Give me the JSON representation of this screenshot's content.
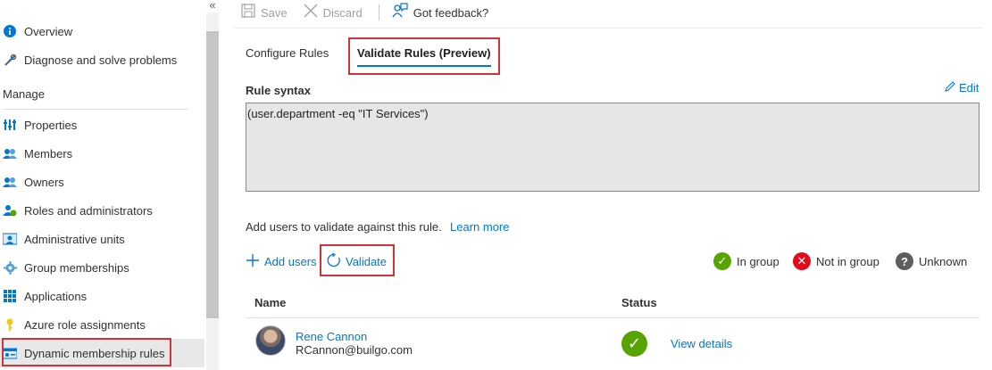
{
  "sidebar": {
    "collapse_glyph": "«",
    "items_top": [
      {
        "label": "Overview",
        "icon": "info-icon"
      },
      {
        "label": "Diagnose and solve problems",
        "icon": "wrench-icon"
      }
    ],
    "section_title": "Manage",
    "items": [
      {
        "label": "Properties",
        "icon": "properties-icon"
      },
      {
        "label": "Members",
        "icon": "members-icon"
      },
      {
        "label": "Owners",
        "icon": "owners-icon"
      },
      {
        "label": "Roles and administrators",
        "icon": "roles-icon"
      },
      {
        "label": "Administrative units",
        "icon": "admin-units-icon"
      },
      {
        "label": "Group memberships",
        "icon": "group-memberships-icon"
      },
      {
        "label": "Applications",
        "icon": "applications-icon"
      },
      {
        "label": "Azure role assignments",
        "icon": "key-icon"
      },
      {
        "label": "Dynamic membership rules",
        "icon": "dynamic-rules-icon",
        "selected": true
      }
    ]
  },
  "toolbar": {
    "save_label": "Save",
    "discard_label": "Discard",
    "feedback_label": "Got feedback?"
  },
  "tabs": {
    "configure": "Configure Rules",
    "validate": "Validate Rules (Preview)",
    "active": "validate"
  },
  "rule": {
    "label": "Rule syntax",
    "edit_label": "Edit",
    "syntax": "(user.department -eq \"IT Services\")"
  },
  "validation": {
    "description": "Add users to validate against this rule.",
    "learn_more": "Learn more",
    "add_users_label": "Add users",
    "validate_label": "Validate"
  },
  "legend": {
    "in_group": "In group",
    "not_in_group": "Not in group",
    "unknown": "Unknown"
  },
  "table": {
    "columns": [
      "Name",
      "Status"
    ],
    "rows": [
      {
        "name": "Rene Cannon",
        "email": "RCannon@builgo.com",
        "status": "in-group",
        "action": "View details"
      }
    ]
  },
  "colors": {
    "accent": "#0078d4",
    "highlight_border": "#d13438",
    "in_group": "#57a300",
    "not_in_group": "#e00b1c",
    "unknown": "#605e5c"
  }
}
